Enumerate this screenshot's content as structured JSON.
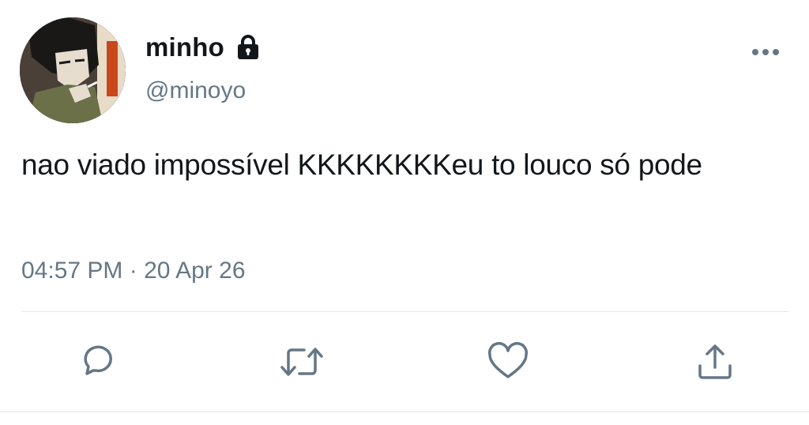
{
  "user": {
    "display_name": "minho",
    "handle": "@minoyo",
    "protected_icon": "lock-icon"
  },
  "tweet": {
    "text": "nao viado impossível KKKKKKKKeu to louco só pode",
    "timestamp": "04:57 PM · 20 Apr 26"
  },
  "actions": {
    "reply": "reply-icon",
    "retweet": "retweet-icon",
    "like": "heart-icon",
    "share": "share-icon"
  },
  "colors": {
    "text": "#14171a",
    "secondary": "#657786",
    "icon": "#657786",
    "divider": "#e1e8ed"
  }
}
